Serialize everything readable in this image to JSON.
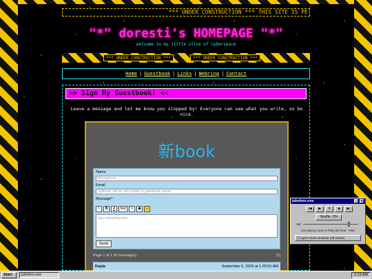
{
  "marquee": "*** UNDER CONSTRUCTION *** THIS SITE IS PE",
  "site": {
    "title": "\"*\" doresti's HOMEPAGE \"*\"",
    "tagline": "welcome to my little slice of cyberspace"
  },
  "construction": {
    "labels": [
      "*** UNDER CONSTRUCTION ***",
      "*** UNDER CONSTRUCTION ***"
    ]
  },
  "nav": {
    "items": [
      "Home",
      "Guestbook",
      "Links",
      "Webring",
      "Contact"
    ],
    "separator": "|"
  },
  "guestbook": {
    "heading": ">> Sign My Guestbook! <<",
    "intro": "Leave a message and let me know you stopped by! Everyone can see what you write, so be nice.",
    "logo": "新book",
    "form": {
      "name_label": "Name",
      "name_placeholder": "Anonymous",
      "email_label": "Email",
      "email_placeholder": "Optional, will be only visible to guestbook owner",
      "message_label": "Message*:",
      "message_placeholder": "Say something nice",
      "send_label": "Send",
      "toolbar": [
        "I",
        "B",
        "A",
        "font",
        "✎",
        "☗",
        "☺"
      ]
    },
    "pagination": {
      "summary": "Page 1 of 1 (8 messages)",
      "nav": "[1]"
    },
    "entries": [
      {
        "name": "Kayla",
        "date": "September 6, 2026 at 1:29:01 AM"
      }
    ]
  },
  "jukebox": {
    "title": "jukebox.exe",
    "controls": [
      "|◀",
      "▶",
      "II",
      "■",
      "▶|"
    ],
    "shuffle_label": "Shuffle: ON",
    "volume_label": "Vol:",
    "volume_level": 0.85,
    "now_playing": "now playing: sparr & Ruby My Dear - Alain",
    "browser_label": "[+] open music browser (45 tracks)"
  },
  "taskbar": {
    "start_label": "Start",
    "tasks": [
      "jukebox.exe"
    ],
    "clock": "2:13 AM"
  }
}
